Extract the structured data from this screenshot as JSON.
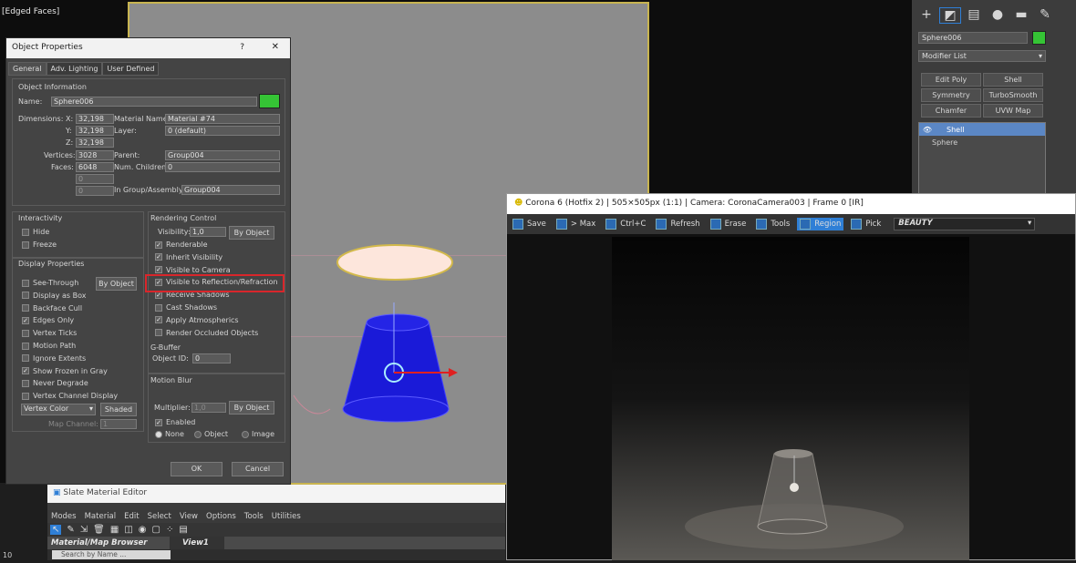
{
  "viewport": {
    "label": "[Edged Faces]"
  },
  "command_panel": {
    "object_name": "Sphere006",
    "modifier_list": "Modifier List",
    "modifiers": [
      "Edit Poly",
      "Shell",
      "Symmetry",
      "TurboSmooth",
      "Chamfer",
      "UVW Map"
    ],
    "stack": [
      "Shell",
      "Sphere"
    ]
  },
  "object_properties": {
    "title": "Object Properties",
    "help": "?",
    "close": "✕",
    "tabs": [
      "General",
      "Adv. Lighting",
      "User Defined"
    ],
    "object_information": "Object Information",
    "name_label": "Name:",
    "name_value": "Sphere006",
    "dimensions_label": "Dimensions:",
    "x_label": "X:",
    "x_value": "32,198",
    "y_label": "Y:",
    "y_value": "32,198",
    "z_label": "Z:",
    "z_value": "32,198",
    "vertices_label": "Vertices:",
    "vertices_value": "3028",
    "faces_label": "Faces:",
    "faces_value": "6048",
    "extra1_value": "0",
    "extra2_value": "0",
    "material_label": "Material Name:",
    "material_value": "Material #74",
    "layer_label": "Layer:",
    "layer_value": "0 (default)",
    "parent_label": "Parent:",
    "parent_value": "Group004",
    "children_label": "Num. Children:",
    "children_value": "0",
    "group_label": "In Group/Assembly:",
    "group_value": "Group004",
    "interactivity": "Interactivity",
    "hide": "Hide",
    "freeze": "Freeze",
    "display_properties": "Display Properties",
    "display_items": [
      {
        "label": "See-Through",
        "checked": false
      },
      {
        "label": "Display as Box",
        "checked": false
      },
      {
        "label": "Backface Cull",
        "checked": false
      },
      {
        "label": "Edges Only",
        "checked": true
      },
      {
        "label": "Vertex Ticks",
        "checked": false
      },
      {
        "label": "Motion Path",
        "checked": false
      },
      {
        "label": "Ignore Extents",
        "checked": false
      },
      {
        "label": "Show Frozen in Gray",
        "checked": true
      },
      {
        "label": "Never Degrade",
        "checked": false
      },
      {
        "label": "Vertex Channel Display",
        "checked": false
      }
    ],
    "by_object": "By Object",
    "vertex_color": "Vertex Color",
    "shaded": "Shaded",
    "map_channel_label": "Map Channel:",
    "map_channel_value": "1",
    "rendering_control": "Rendering Control",
    "visibility_label": "Visibility:",
    "visibility_value": "1,0",
    "render_items": [
      {
        "label": "Renderable",
        "checked": true
      },
      {
        "label": "Inherit Visibility",
        "checked": true
      },
      {
        "label": "Visible to Camera",
        "checked": true
      },
      {
        "label": "Visible to Reflection/Refraction",
        "checked": true
      },
      {
        "label": "Receive Shadows",
        "checked": true
      },
      {
        "label": "Cast Shadows",
        "checked": false
      },
      {
        "label": "Apply Atmospherics",
        "checked": true
      },
      {
        "label": "Render Occluded Objects",
        "checked": false
      }
    ],
    "gbuffer": "G-Buffer",
    "object_id_label": "Object ID:",
    "object_id_value": "0",
    "motion_blur": "Motion Blur",
    "multiplier_label": "Multiplier:",
    "multiplier_value": "1,0",
    "enabled": "Enabled",
    "radio_none": "None",
    "radio_object": "Object",
    "radio_image": "Image",
    "ok": "OK",
    "cancel": "Cancel"
  },
  "corona": {
    "title": "Corona 6 (Hotfix 2) | 505×505px (1:1) | Camera: CoronaCamera003 | Frame 0 [IR]",
    "toolbar": [
      "Save",
      "> Max",
      "Ctrl+C",
      "Refresh",
      "Erase",
      "Tools",
      "Region",
      "Pick"
    ],
    "active": "Region",
    "pass": "BEAUTY"
  },
  "slate": {
    "title": "Slate Material Editor",
    "menu": [
      "Modes",
      "Material",
      "Edit",
      "Select",
      "View",
      "Options",
      "Tools",
      "Utilities"
    ],
    "browser": "Material/Map Browser",
    "search_placeholder": "Search by Name ...",
    "view": "View1",
    "corner": "10"
  },
  "colors": {
    "object_color": "#35c435",
    "accent": "#2f7fd6",
    "highlight_red": "#d9262b"
  }
}
